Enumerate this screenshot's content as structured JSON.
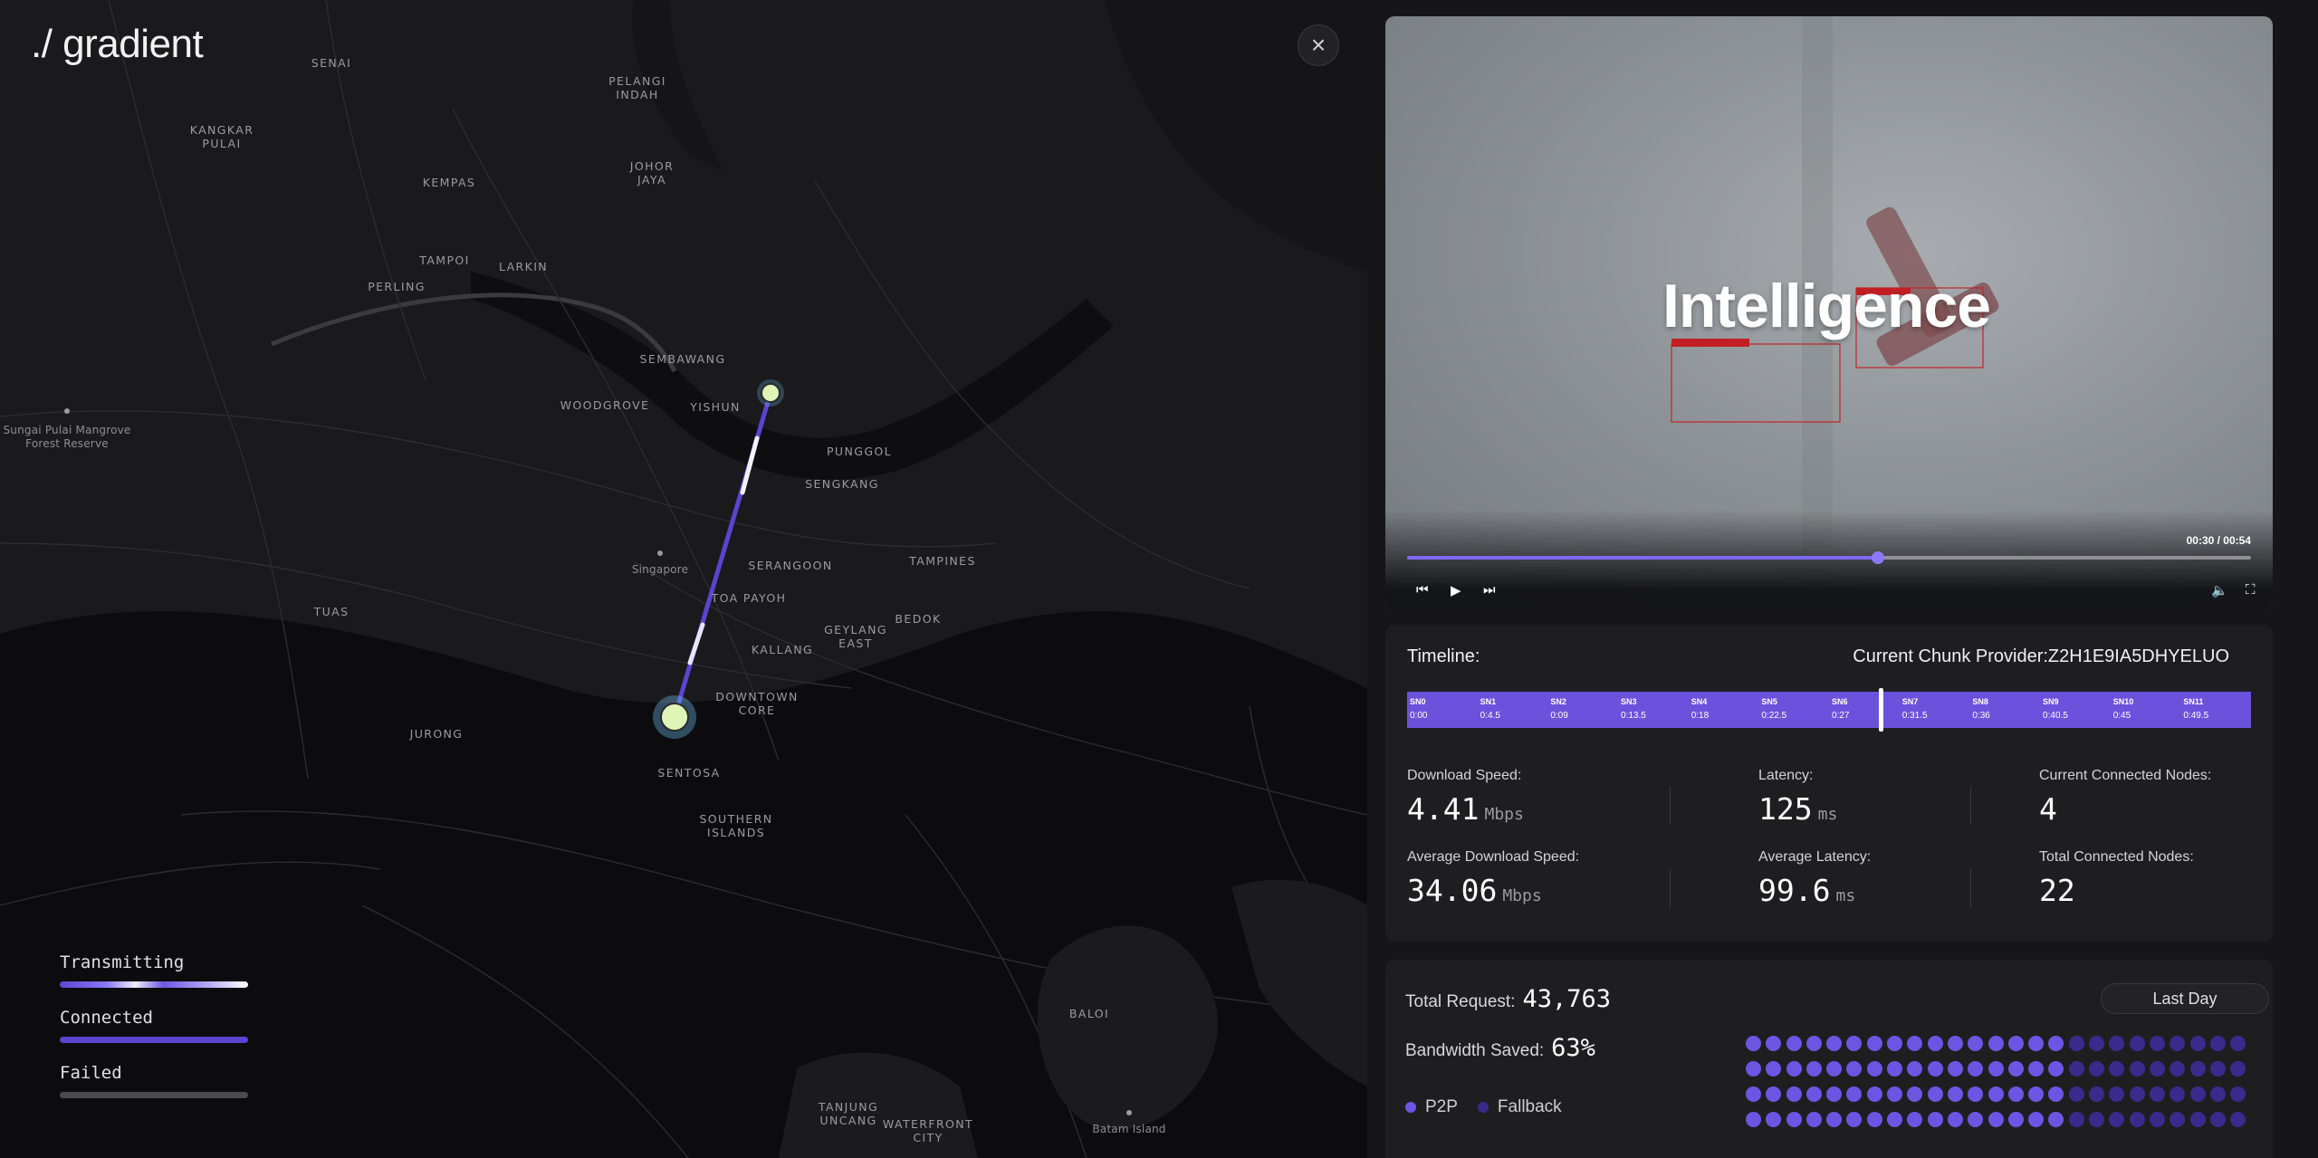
{
  "app": {
    "logo": "./ gradient"
  },
  "map": {
    "places": [
      {
        "name": "SENAI"
      },
      {
        "name": "PELANGI\nINDAH"
      },
      {
        "name": "KANGKAR\nPULAI"
      },
      {
        "name": "JOHOR\nJAYA"
      },
      {
        "name": "KEMPAS"
      },
      {
        "name": "TAMPOI"
      },
      {
        "name": "LARKIN"
      },
      {
        "name": "PERLING"
      },
      {
        "name": "SEMBAWANG"
      },
      {
        "name": "WOODGROVE"
      },
      {
        "name": "YISHUN"
      },
      {
        "name": "PUNGGOL"
      },
      {
        "name": "SENGKANG"
      },
      {
        "name": "SERANGOON"
      },
      {
        "name": "TAMPINES"
      },
      {
        "name": "TOA PAYOH"
      },
      {
        "name": "BEDOK"
      },
      {
        "name": "GEYLANG\nEAST"
      },
      {
        "name": "KALLANG"
      },
      {
        "name": "TUAS"
      },
      {
        "name": "DOWNTOWN\nCORE"
      },
      {
        "name": "JURONG"
      },
      {
        "name": "SENTOSA"
      },
      {
        "name": "SOUTHERN\nISLANDS"
      },
      {
        "name": "BALOI"
      },
      {
        "name": "TANJUNG\nUNCANG"
      },
      {
        "name": "WATERFRONT\nCITY"
      }
    ],
    "pois": [
      {
        "name": "Sungai Pulai Mangrove\nForest Reserve"
      },
      {
        "name": "Singapore"
      },
      {
        "name": "Batam Island"
      }
    ],
    "close_icon": "close-icon",
    "legend": {
      "transmitting": "Transmitting",
      "connected": "Connected",
      "failed": "Failed"
    }
  },
  "video": {
    "overlay_text": "Intelligence",
    "time": "00:30 / 00:54",
    "progress": 0.558
  },
  "timeline": {
    "label": "Timeline:",
    "provider_label": "Current Chunk Provider:",
    "provider_id": "Z2H1E9IA5DHYELUO",
    "current_position": 0.561,
    "segments": [
      {
        "sn": "SN0",
        "t": "0:00"
      },
      {
        "sn": "SN1",
        "t": "0:4.5"
      },
      {
        "sn": "SN2",
        "t": "0:09"
      },
      {
        "sn": "SN3",
        "t": "0:13.5"
      },
      {
        "sn": "SN4",
        "t": "0:18"
      },
      {
        "sn": "SN5",
        "t": "0:22.5"
      },
      {
        "sn": "SN6",
        "t": "0:27"
      },
      {
        "sn": "SN7",
        "t": "0:31.5"
      },
      {
        "sn": "SN8",
        "t": "0:36"
      },
      {
        "sn": "SN9",
        "t": "0:40.5"
      },
      {
        "sn": "SN10",
        "t": "0:45"
      },
      {
        "sn": "SN11",
        "t": "0:49.5"
      }
    ]
  },
  "stats": {
    "download_speed": {
      "label": "Download Speed:",
      "value": "4.41",
      "unit": "Mbps"
    },
    "latency": {
      "label": "Latency:",
      "value": "125",
      "unit": "ms"
    },
    "current_nodes": {
      "label": "Current Connected Nodes:",
      "value": "4"
    },
    "avg_download_speed": {
      "label": "Average Download Speed:",
      "value": "34.06",
      "unit": "Mbps"
    },
    "avg_latency": {
      "label": "Average Latency:",
      "value": "99.6",
      "unit": "ms"
    },
    "total_nodes": {
      "label": "Total Connected Nodes:",
      "value": "22"
    }
  },
  "summary": {
    "total_request_label": "Total Request:",
    "total_request_value": "43,763",
    "bandwidth_saved_label": "Bandwidth Saved:",
    "bandwidth_saved_value": "63%",
    "range_button": "Last Day",
    "legend_p2p": "P2P",
    "legend_fallback": "Fallback",
    "p2p_color": "#6d55e3",
    "fallback_color": "#3a2a8c",
    "dot_grid": {
      "rows": 4,
      "cols": 25,
      "p2p_cols": 16
    }
  }
}
